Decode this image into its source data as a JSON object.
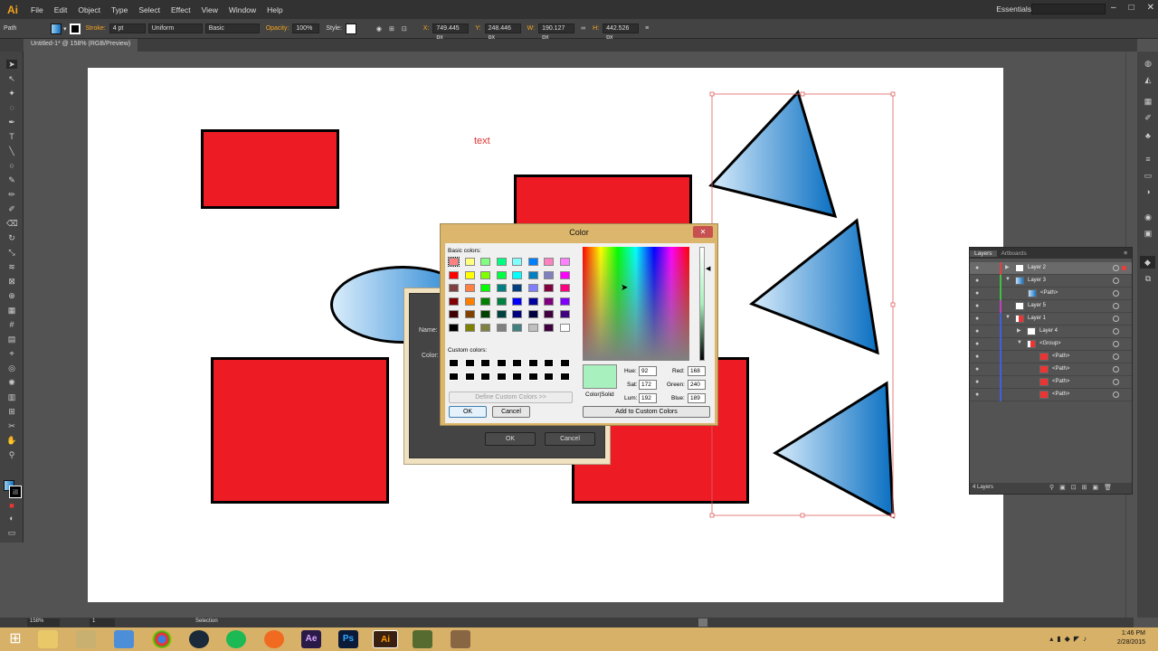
{
  "app": {
    "logo": "Ai",
    "workspace": "Essentials"
  },
  "menu": [
    "File",
    "Edit",
    "Object",
    "Type",
    "Select",
    "Effect",
    "View",
    "Window",
    "Help"
  ],
  "control": {
    "selection_type": "Path",
    "stroke_label": "Stroke:",
    "stroke_weight": "4 pt",
    "profile": "Uniform",
    "brush": "Basic",
    "opacity_label": "Opacity:",
    "opacity": "100%",
    "style_label": "Style:",
    "x_label": "X:",
    "x": "749.445 px",
    "y_label": "Y:",
    "y": "248.446 px",
    "w_label": "W:",
    "w": "190.127 px",
    "h_label": "H:",
    "h": "442.526 px"
  },
  "document_tab": "Untitled-1* @ 158% (RGB/Preview)",
  "canvas": {
    "text_object": "text"
  },
  "new_swatch_dialog": {
    "name_label": "Name:",
    "color_label": "Color:",
    "ok": "OK",
    "cancel": "Cancel"
  },
  "color_dialog": {
    "title": "Color",
    "close": "✕",
    "basic_label": "Basic colors:",
    "custom_label": "Custom colors:",
    "define_custom": "Define Custom Colors >>",
    "ok": "OK",
    "cancel": "Cancel",
    "solid_label": "Color|Solid",
    "hue_label": "Hue:",
    "hue": "92",
    "sat_label": "Sat:",
    "sat": "172",
    "lum_label": "Lum:",
    "lum": "192",
    "red_label": "Red:",
    "red": "168",
    "green_label": "Green:",
    "green": "240",
    "blue_label": "Blue:",
    "blue": "189",
    "add_custom": "Add to Custom Colors",
    "current_color": "#a8f0bd",
    "basic_colors": [
      [
        "#ff8080",
        "#ffff80",
        "#80ff80",
        "#00ff80",
        "#80ffff",
        "#0080ff",
        "#ff80c0",
        "#ff80ff"
      ],
      [
        "#ff0000",
        "#ffff00",
        "#80ff00",
        "#00ff40",
        "#00ffff",
        "#0080c0",
        "#8080c0",
        "#ff00ff"
      ],
      [
        "#804040",
        "#ff8040",
        "#00ff00",
        "#008080",
        "#004080",
        "#8080ff",
        "#800040",
        "#ff0080"
      ],
      [
        "#800000",
        "#ff8000",
        "#008000",
        "#008040",
        "#0000ff",
        "#0000a0",
        "#800080",
        "#8000ff"
      ],
      [
        "#400000",
        "#804000",
        "#004000",
        "#004040",
        "#000080",
        "#000040",
        "#400040",
        "#400080"
      ],
      [
        "#000000",
        "#808000",
        "#808040",
        "#808080",
        "#408080",
        "#c0c0c0",
        "#400040",
        "#ffffff"
      ]
    ]
  },
  "layers_panel": {
    "tab_layers": "Layers",
    "tab_artboards": "Artboards",
    "rows": [
      {
        "name": "Layer 2",
        "color": "#e04040"
      },
      {
        "name": "Layer 3",
        "color": "#40c040"
      },
      {
        "name": "<Path>",
        "color": "#40c040"
      },
      {
        "name": "Layer 5",
        "color": "#c040c0"
      },
      {
        "name": "Layer 1",
        "color": "#4060e0"
      },
      {
        "name": "Layer 4",
        "color": "#4060e0"
      },
      {
        "name": "<Group>",
        "color": "#4060e0"
      },
      {
        "name": "<Path>",
        "color": "#4060e0"
      },
      {
        "name": "<Path>",
        "color": "#4060e0"
      },
      {
        "name": "<Path>",
        "color": "#4060e0"
      },
      {
        "name": "<Path>",
        "color": "#4060e0"
      }
    ],
    "footer": "4 Layers"
  },
  "status": {
    "zoom": "158%",
    "artboard_num": "1",
    "tool": "Selection"
  },
  "clock": {
    "time": "1:46 PM",
    "date": "2/28/2015"
  }
}
